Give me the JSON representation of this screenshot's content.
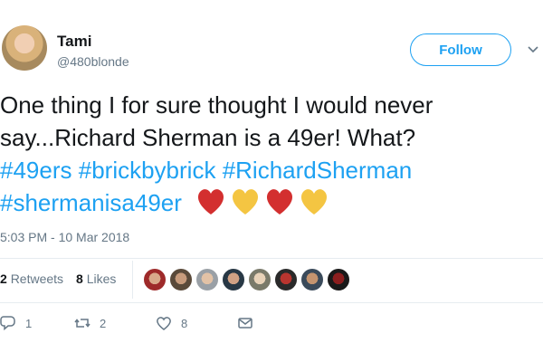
{
  "user": {
    "name": "Tami",
    "handle": "@480blonde"
  },
  "follow_label": "Follow",
  "tweet": {
    "line1": "One thing I for sure thought I would never",
    "line2": "say...Richard Sherman is a 49er! What?",
    "tag1": "#49ers",
    "tag2": "#brickbybrick",
    "tag3": "#RichardSherman",
    "tag4": "#shermanisa49er"
  },
  "emojis": [
    "red-heart",
    "yellow-heart",
    "red-heart",
    "yellow-heart"
  ],
  "timestamp": "5:03 PM - 10 Mar 2018",
  "stats": {
    "retweets_count": "2",
    "retweets_label": "Retweets",
    "likes_count": "8",
    "likes_label": "Likes"
  },
  "actions": {
    "reply_count": "1",
    "retweet_count": "2",
    "like_count": "8"
  },
  "colors": {
    "accent": "#1da1f2",
    "heart_red": "#d32f2f",
    "heart_yellow": "#f4c542",
    "muted": "#657786"
  }
}
